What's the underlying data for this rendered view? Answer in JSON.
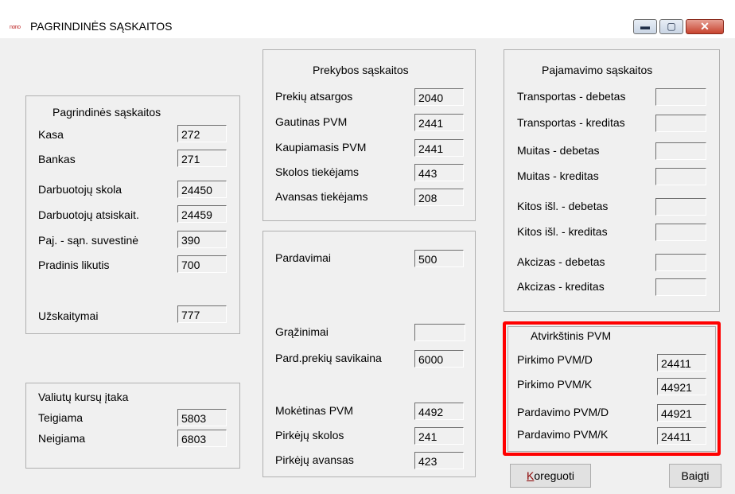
{
  "window": {
    "icon_text": "nono",
    "title": "PAGRINDINĖS SĄSKAITOS"
  },
  "main_group": {
    "title": "Pagrindinės sąskaitos",
    "rows": [
      {
        "label": "Kasa",
        "value": "272"
      },
      {
        "label": "Bankas",
        "value": "271"
      },
      {
        "label": "Darbuotojų skola",
        "value": "24450"
      },
      {
        "label": "Darbuotojų atsiskait.",
        "value": "24459"
      },
      {
        "label": "Paj. - sąn. suvestinė",
        "value": "390"
      },
      {
        "label": "Pradinis likutis",
        "value": "700"
      },
      {
        "label": "Užskaitymai",
        "value": "777"
      }
    ]
  },
  "currency_group": {
    "title": "Valiutų kursų įtaka",
    "rows": [
      {
        "label": "Teigiama",
        "value": "5803"
      },
      {
        "label": "Neigiama",
        "value": "6803"
      }
    ]
  },
  "trade_group": {
    "title": "Prekybos sąskaitos",
    "rows": [
      {
        "label": "Prekių atsargos",
        "value": "2040"
      },
      {
        "label": "Gautinas PVM",
        "value": "2441"
      },
      {
        "label": "Kaupiamasis PVM",
        "value": "2441"
      },
      {
        "label": "Skolos tiekėjams",
        "value": "443"
      },
      {
        "label": "Avansas tiekėjams",
        "value": "208"
      }
    ]
  },
  "sales_group": {
    "rows": [
      {
        "label": "Pardavimai",
        "value": "500"
      },
      {
        "label": "Grąžinimai",
        "value": ""
      },
      {
        "label": "Pard.prekių savikaina",
        "value": "6000"
      },
      {
        "label": "Mokėtinas PVM",
        "value": "4492"
      },
      {
        "label": "Pirkėjų skolos",
        "value": "241"
      },
      {
        "label": "Pirkėjų avansas",
        "value": "423"
      }
    ]
  },
  "income_group": {
    "title": "Pajamavimo sąskaitos",
    "rows": [
      {
        "label": "Transportas - debetas",
        "value": ""
      },
      {
        "label": "Transportas - kreditas",
        "value": ""
      },
      {
        "label": "Muitas - debetas",
        "value": ""
      },
      {
        "label": "Muitas - kreditas",
        "value": ""
      },
      {
        "label": "Kitos išl. - debetas",
        "value": ""
      },
      {
        "label": "Kitos išl. - kreditas",
        "value": ""
      },
      {
        "label": "Akcizas - debetas",
        "value": ""
      },
      {
        "label": "Akcizas - kreditas",
        "value": ""
      }
    ]
  },
  "reverse_vat_group": {
    "title": "Atvirkštinis PVM",
    "rows": [
      {
        "label": "Pirkimo PVM/D",
        "value": "24411"
      },
      {
        "label": "Pirkimo PVM/K",
        "value": "44921"
      },
      {
        "label": "Pardavimo PVM/D",
        "value": "44921"
      },
      {
        "label": "Pardavimo PVM/K",
        "value": "24411"
      }
    ],
    "highlight_color": "#ff0000"
  },
  "buttons": {
    "edit_hotkey": "K",
    "edit_rest": "oreguoti",
    "finish": "Baigti"
  }
}
